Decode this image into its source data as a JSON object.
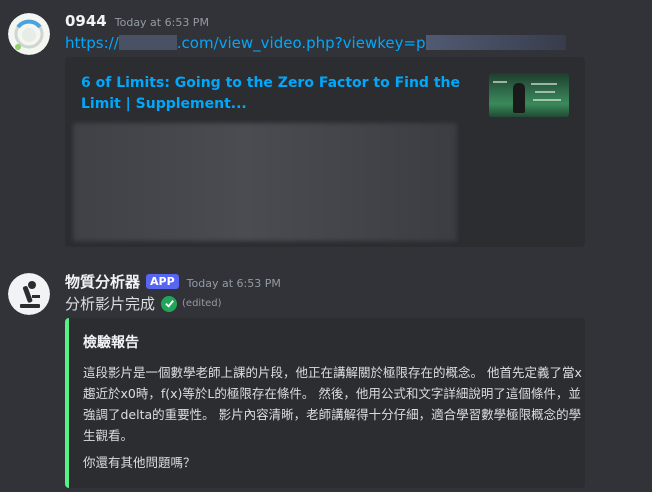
{
  "message1": {
    "username": "0944",
    "timestamp": "Today at 6:53 PM",
    "link_prefix": "https://",
    "link_middle": ".com/view_video.php?viewkey=p",
    "embed": {
      "title": "6 of Limits: Going to the Zero Factor to Find the Limit | Supplement..."
    }
  },
  "message2": {
    "username": "物質分析器",
    "badge": "APP",
    "timestamp": "Today at 6:53 PM",
    "content": "分析影片完成",
    "edited": "(edited)",
    "embed": {
      "title": "檢驗報告",
      "body": "這段影片是一個數學老師上課的片段，他正在講解關於極限存在的概念。 他首先定義了當x趨近於x0時，f(x)等於L的極限存在條件。 然後，他用公式和文字詳細說明了這個條件，並強調了delta的重要性。 影片內容清晰，老師講解得十分仔細，適合學習數學極限概念的學生觀看。",
      "question": "你還有其他問題嗎？",
      "accent": "#57f287"
    }
  },
  "colors": {
    "background": "#313338",
    "embed_bg": "#2b2d31",
    "link": "#00a8fc",
    "badge": "#5865f2",
    "check": "#23a559"
  }
}
